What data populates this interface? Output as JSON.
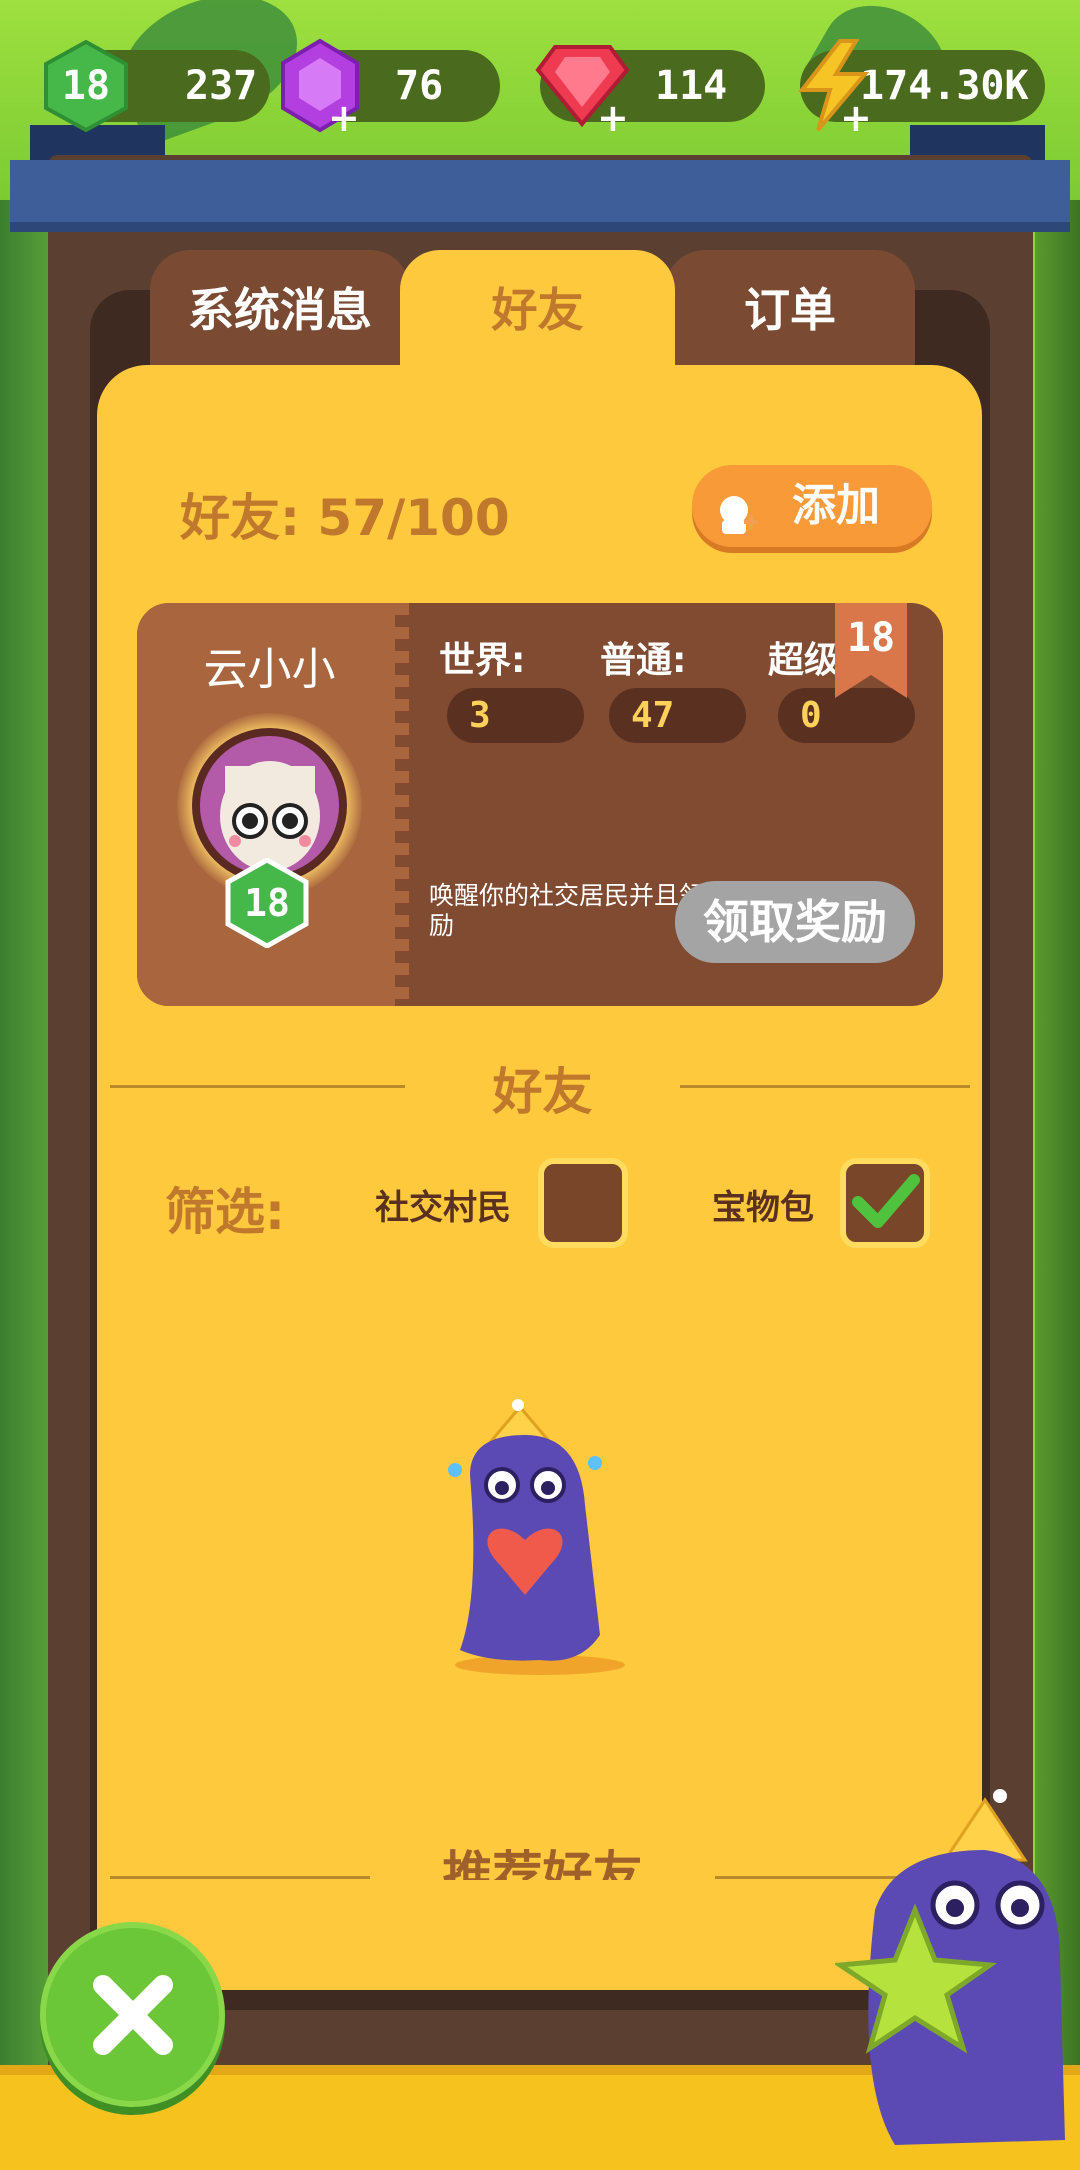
{
  "currency_bar": {
    "level": "18",
    "xp": "237",
    "purple_gems": "76",
    "red_gems": "114",
    "energy": "174.30K",
    "level_icon": "green-hexagon-icon",
    "purple_icon": "purple-gem-icon",
    "red_icon": "red-gem-icon",
    "energy_icon": "lightning-bolt-icon"
  },
  "tabs": [
    {
      "label": "系统消息",
      "active": false
    },
    {
      "label": "好友",
      "active": true
    },
    {
      "label": "订单",
      "active": false
    }
  ],
  "friends": {
    "count_text": "好友: 57/100",
    "add_label": "添加"
  },
  "profile": {
    "name": "云小小",
    "level": "18",
    "rank_badge": "18",
    "stats": [
      {
        "label": "世界:",
        "value": "3"
      },
      {
        "label": "普通:",
        "value": "47"
      },
      {
        "label": "超级:",
        "value": "0"
      }
    ],
    "description": "唤醒你的社交居民并且领取奖励",
    "claim_label": "领取奖励"
  },
  "friends_section": {
    "title": "好友",
    "filter_label": "筛选:",
    "filters": [
      {
        "label": "社交村民",
        "checked": false
      },
      {
        "label": "宝物包",
        "checked": true
      }
    ]
  },
  "recommended": {
    "title": "推荐好友"
  },
  "colors": {
    "panel": "#fec93c",
    "tab_inactive": "#7b4a32",
    "card": "#814b32",
    "add_button": "#f79a37",
    "close_button": "#6bc638"
  }
}
